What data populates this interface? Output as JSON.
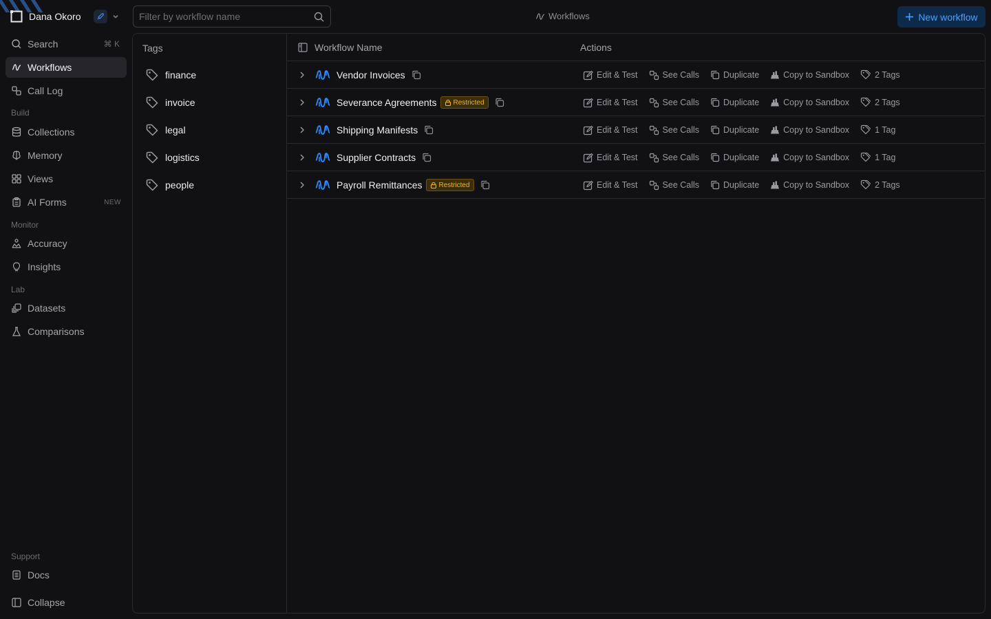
{
  "user": {
    "name": "Dana Okoro"
  },
  "sidebar": {
    "search": {
      "label": "Search",
      "shortcut": "⌘ K"
    },
    "top_items": [
      {
        "label": "Workflows",
        "icon": "workflow-icon",
        "active": true
      },
      {
        "label": "Call Log",
        "icon": "call-log-icon"
      }
    ],
    "sections": [
      {
        "title": "Build",
        "items": [
          {
            "label": "Collections",
            "icon": "database-icon"
          },
          {
            "label": "Memory",
            "icon": "brain-icon"
          },
          {
            "label": "Views",
            "icon": "grid-icon"
          },
          {
            "label": "AI Forms",
            "icon": "clipboard-icon",
            "badge": "NEW"
          }
        ]
      },
      {
        "title": "Monitor",
        "items": [
          {
            "label": "Accuracy",
            "icon": "target-icon"
          },
          {
            "label": "Insights",
            "icon": "lightbulb-icon"
          }
        ]
      },
      {
        "title": "Lab",
        "items": [
          {
            "label": "Datasets",
            "icon": "datasets-icon"
          },
          {
            "label": "Comparisons",
            "icon": "flask-icon"
          }
        ]
      }
    ],
    "support": {
      "title": "Support",
      "docs": "Docs",
      "collapse": "Collapse"
    }
  },
  "topbar": {
    "search_placeholder": "Filter by workflow name",
    "title": "Workflows",
    "new_button": "New workflow"
  },
  "tags_panel": {
    "header": "Tags",
    "tags": [
      "finance",
      "invoice",
      "legal",
      "logistics",
      "people"
    ]
  },
  "table": {
    "col_name": "Workflow Name",
    "col_actions": "Actions",
    "action_labels": {
      "edit": "Edit & Test",
      "calls": "See Calls",
      "duplicate": "Duplicate",
      "sandbox": "Copy to Sandbox"
    },
    "rows": [
      {
        "name": "Vendor Invoices",
        "restricted": false,
        "tags": "2 Tags"
      },
      {
        "name": "Severance Agreements",
        "restricted": true,
        "tags": "2 Tags"
      },
      {
        "name": "Shipping Manifests",
        "restricted": false,
        "tags": "1 Tag"
      },
      {
        "name": "Supplier Contracts",
        "restricted": false,
        "tags": "1 Tag"
      },
      {
        "name": "Payroll Remittances",
        "restricted": true,
        "tags": "2 Tags"
      }
    ],
    "restricted_label": "Restricted"
  },
  "colors": {
    "accent": "#2f8cff",
    "warning": "#f0b429",
    "background": "#111113"
  }
}
